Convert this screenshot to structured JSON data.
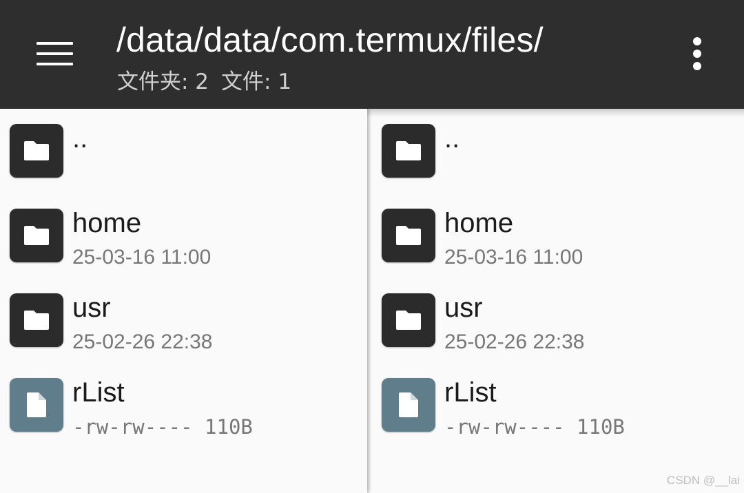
{
  "header": {
    "path": "/data/data/com.termux/files/",
    "folders_label": "文件夹: 2",
    "files_label": "文件: 1"
  },
  "panes": [
    {
      "items": [
        {
          "name": "..",
          "meta": "",
          "type": "folder"
        },
        {
          "name": "home",
          "meta": "25-03-16 11:00",
          "type": "folder"
        },
        {
          "name": "usr",
          "meta": "25-02-26 22:38",
          "type": "folder"
        },
        {
          "name": "rList",
          "meta": "-rw-rw---- 110B",
          "type": "file"
        }
      ]
    },
    {
      "items": [
        {
          "name": "..",
          "meta": "",
          "type": "folder"
        },
        {
          "name": "home",
          "meta": "25-03-16 11:00",
          "type": "folder"
        },
        {
          "name": "usr",
          "meta": "25-02-26 22:38",
          "type": "folder"
        },
        {
          "name": "rList",
          "meta": "-rw-rw---- 110B",
          "type": "file"
        }
      ]
    }
  ],
  "watermark": "CSDN @__lai",
  "colors": {
    "appbar": "#2e2e2e",
    "folder_tile": "#2b2b2b",
    "file_tile": "#607d8b",
    "background": "#fafafa"
  },
  "icons": {
    "menu": "hamburger-menu-icon",
    "overflow": "more-vert-icon",
    "folder": "folder-icon",
    "file": "file-icon"
  }
}
